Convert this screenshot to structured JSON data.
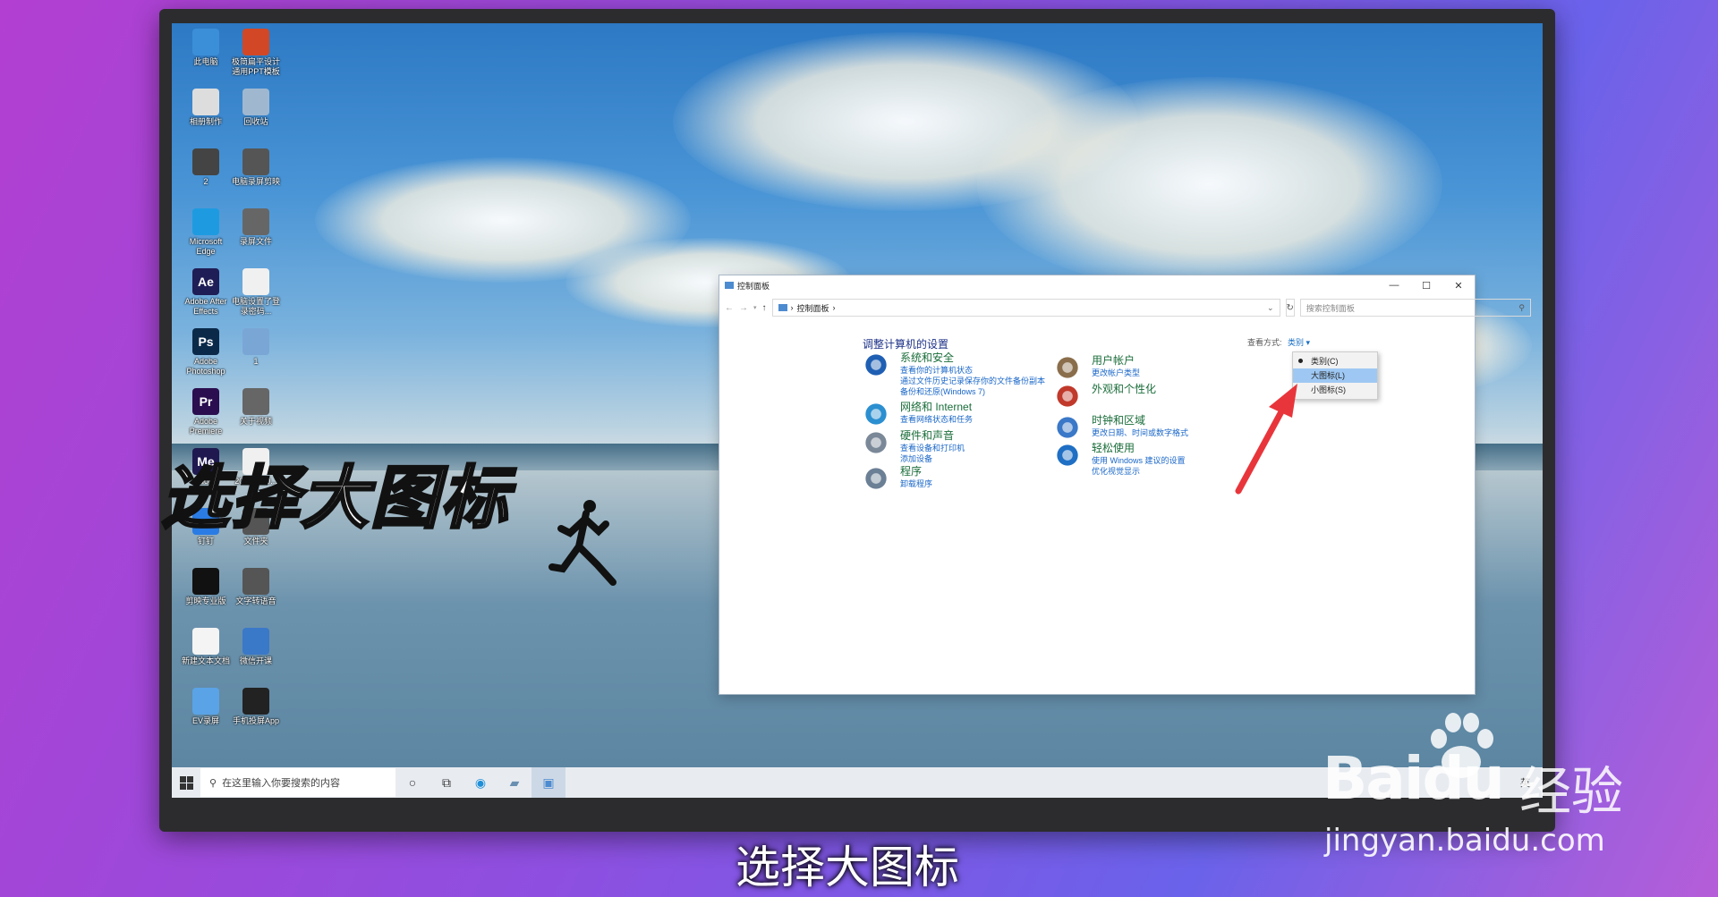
{
  "desktop_icons": [
    {
      "label": "此电脑",
      "icon": "computer-icon",
      "color": "#3b8fd8"
    },
    {
      "label": "极简扁平设计通用PPT模板",
      "icon": "ppt-file-icon",
      "color": "#d24726"
    },
    {
      "label": "相册制作",
      "icon": "usb-drive-icon",
      "color": "#dddddd"
    },
    {
      "label": "回收站",
      "icon": "recycle-bin-icon",
      "color": "#9fb8cf"
    },
    {
      "label": "2",
      "icon": "image-file-icon",
      "color": "#444444"
    },
    {
      "label": "电脑录屏剪映",
      "icon": "video-file-icon",
      "color": "#555555"
    },
    {
      "label": "Microsoft Edge",
      "icon": "edge-icon",
      "color": "#1e9be0"
    },
    {
      "label": "录屏文件",
      "icon": "video-file-icon",
      "color": "#666666"
    },
    {
      "label": "Adobe After Effects",
      "icon": "after-effects-icon",
      "glyph": "Ae",
      "color": "#1f1d55"
    },
    {
      "label": "电脑设置了登录密码...",
      "icon": "document-icon",
      "color": "#f0f0f0"
    },
    {
      "label": "Adobe Photoshop",
      "icon": "photoshop-icon",
      "glyph": "Ps",
      "color": "#0b2a4a"
    },
    {
      "label": "1",
      "icon": "image-file-icon",
      "color": "#7aa6d6"
    },
    {
      "label": "Adobe Premiere",
      "icon": "premiere-icon",
      "glyph": "Pr",
      "color": "#2a0e4f"
    },
    {
      "label": "关于视频",
      "icon": "video-file-icon",
      "color": "#666666"
    },
    {
      "label": "Adobe Media...",
      "icon": "media-encoder-icon",
      "glyph": "Me",
      "color": "#1f1950"
    },
    {
      "label": "20221210...",
      "icon": "document-icon",
      "color": "#f0f0f0"
    },
    {
      "label": "钉钉",
      "icon": "dingtalk-icon",
      "color": "#2a7be4"
    },
    {
      "label": "文件夹",
      "icon": "video-file-icon",
      "color": "#555555"
    },
    {
      "label": "剪映专业版",
      "icon": "capcut-icon",
      "color": "#111111"
    },
    {
      "label": "文字转语音",
      "icon": "video-file-icon",
      "color": "#555555"
    },
    {
      "label": "新建文本文档",
      "icon": "text-file-icon",
      "color": "#f4f4f4"
    },
    {
      "label": "微信开课",
      "icon": "app-icon",
      "color": "#3a78c8"
    },
    {
      "label": "EV录屏",
      "icon": "ev-recorder-icon",
      "color": "#5aa3e6"
    },
    {
      "label": "手机投屏App",
      "icon": "phone-app-icon",
      "color": "#222222"
    }
  ],
  "taskbar": {
    "search_placeholder": "在这里输入你要搜索的内容",
    "tray_lang": "英",
    "icons": [
      "windows-start-icon",
      "search-icon",
      "cortana-icon",
      "task-view-icon",
      "edge-icon",
      "file-explorer-icon",
      "control-panel-icon"
    ]
  },
  "window": {
    "title": "控制面板",
    "address": "控制面板",
    "search_placeholder": "搜索控制面板",
    "heading": "调整计算机的设置",
    "view_by_label": "查看方式:",
    "view_by_value": "类别 ▾",
    "categories": [
      {
        "title": "系统和安全",
        "links": [
          "查看你的计算机状态",
          "通过文件历史记录保存你的文件备份副本",
          "备份和还原(Windows 7)"
        ],
        "icon": "shield-icon"
      },
      {
        "title": "网络和 Internet",
        "links": [
          "查看网络状态和任务"
        ],
        "icon": "network-globe-icon"
      },
      {
        "title": "硬件和声音",
        "links": [
          "查看设备和打印机",
          "添加设备"
        ],
        "icon": "printer-icon"
      },
      {
        "title": "程序",
        "links": [
          "卸载程序"
        ],
        "icon": "programs-icon"
      },
      {
        "title": "用户帐户",
        "links": [
          "更改帐户类型"
        ],
        "icon": "users-icon"
      },
      {
        "title": "外观和个性化",
        "links": [],
        "icon": "personalization-icon"
      },
      {
        "title": "时钟和区域",
        "links": [
          "更改日期、时间或数字格式"
        ],
        "icon": "clock-icon"
      },
      {
        "title": "轻松使用",
        "links": [
          "使用 Windows 建议的设置",
          "优化视觉显示"
        ],
        "icon": "ease-of-access-icon"
      }
    ],
    "view_menu": [
      "类别(C)",
      "大图标(L)",
      "小图标(S)"
    ],
    "view_menu_selected": 1,
    "view_menu_checked": 0
  },
  "captions": {
    "overlay": "选择大图标",
    "subtitle": "选择大图标"
  },
  "watermark": {
    "brand": "Baidu",
    "cn": "经验",
    "url": "jingyan.baidu.com"
  },
  "colors": {
    "accent_link": "#1a67c8",
    "category_title": "#1a6d3a",
    "heading": "#1e3287",
    "menu_highlight": "#9ec8f3",
    "arrow": "#e8353b"
  }
}
